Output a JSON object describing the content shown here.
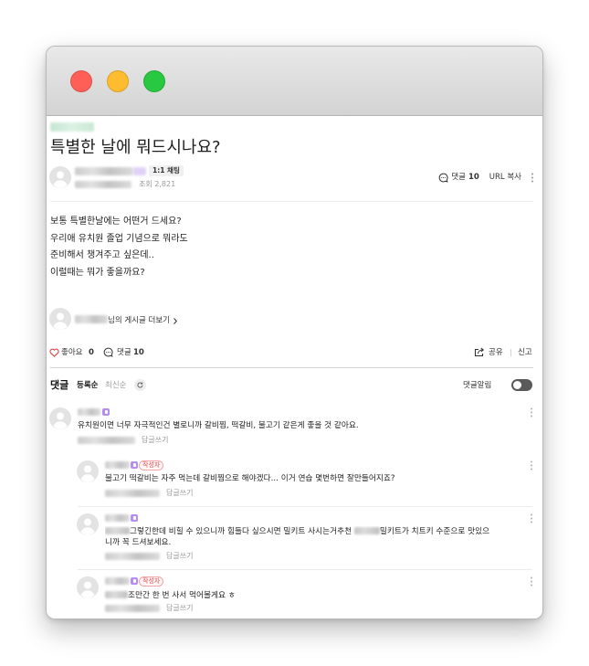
{
  "colors": {
    "close": "#ff5f57",
    "minimize": "#febc2e",
    "zoom": "#28c840",
    "like_heart": "#e5484d",
    "author_tag": "#e5484d",
    "member_badge": "#b48ef2",
    "toggle_off": "#5a5a5a"
  },
  "icons": {
    "comment": "comment-icon",
    "like": "heart-icon",
    "share": "share-icon",
    "refresh": "refresh-icon",
    "more": "more-vertical-icon",
    "chevron": "chevron-right-icon",
    "avatar": "user-avatar-icon"
  },
  "post": {
    "title": "특별한 날에 뭐드시나요?",
    "chat_badge": "1:1 채팅",
    "views": "조회 2,821",
    "comment_label": "댓글",
    "comment_count": "10",
    "url_copy": "URL 복사",
    "body": [
      "보통 특별한날에는 어떤거 드세요?",
      "우리애 유치원 졸업 기념으로 뭐라도",
      "준비해서 챙겨주고 싶은데..",
      "이럴때는 뭐가 좋을까요?"
    ],
    "more_posts": "님의 게시글 더보기"
  },
  "actions": {
    "like_label": "좋아요",
    "like_count": "0",
    "comment_label": "댓글",
    "comment_count": "10",
    "share_label": "공유",
    "report_label": "신고"
  },
  "comment_section": {
    "title": "댓글",
    "sort_options": [
      "등록순",
      "최신순"
    ],
    "selected_sort": "등록순",
    "notify_label": "댓글알림",
    "notify_enabled": false
  },
  "comments": [
    {
      "reply": false,
      "author_tag": "",
      "lines": [
        "유치원이면 너무 자극적인건 별로니까 갈비찜, 떡갈비, 불고기 같은게 좋을 것 같아요."
      ],
      "reply_label": "답글쓰기"
    },
    {
      "reply": true,
      "author_tag": "작성자",
      "lines": [
        "불고기 떡갈비는 자주 먹는데 갈비찜으로 해야겠다... 이거 연습 몇번하면 잘만들어지죠?"
      ],
      "reply_label": "답글쓰기"
    },
    {
      "reply": true,
      "author_tag": "",
      "lines": [
        "그렇긴한데 비힐 수 있으니까 힘들다 싶으시면 밀키트 사시는거추천",
        "밀키트가 치트키 수준으로 맛있으",
        "니까 꼭 드셔보세요."
      ],
      "reply_label": "답글쓰기"
    },
    {
      "reply": true,
      "author_tag": "작성자",
      "lines": [
        "조만간 한 번 사서 먹어볼게요 ㅎ"
      ],
      "reply_label": "답글쓰기"
    }
  ]
}
